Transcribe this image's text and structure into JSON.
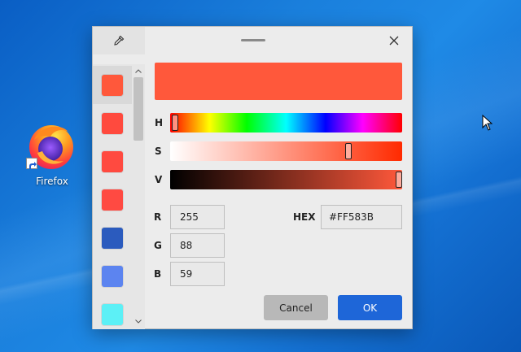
{
  "desktop": {
    "icon_label": "Firefox"
  },
  "dialog": {
    "swatches": [
      {
        "color": "#FF583B",
        "selected": true
      },
      {
        "color": "#FF4A3E"
      },
      {
        "color": "#FF4A40"
      },
      {
        "color": "#FF4A42"
      },
      {
        "color": "#2B5BBE"
      },
      {
        "color": "#5C84F0"
      },
      {
        "color": "#5CF0F6"
      }
    ],
    "preview_color": "#FF583B",
    "hue_label": "H",
    "saturation_label": "S",
    "value_label": "V",
    "hue_level": 0.02,
    "saturation_level": 0.77,
    "value_level": 1.0,
    "r_label": "R",
    "g_label": "G",
    "b_label": "B",
    "r_value": "255",
    "g_value": "88",
    "b_value": "59",
    "hex_label": "HEX",
    "hex_value": "#FF583B",
    "cancel_label": "Cancel",
    "ok_label": "OK"
  }
}
